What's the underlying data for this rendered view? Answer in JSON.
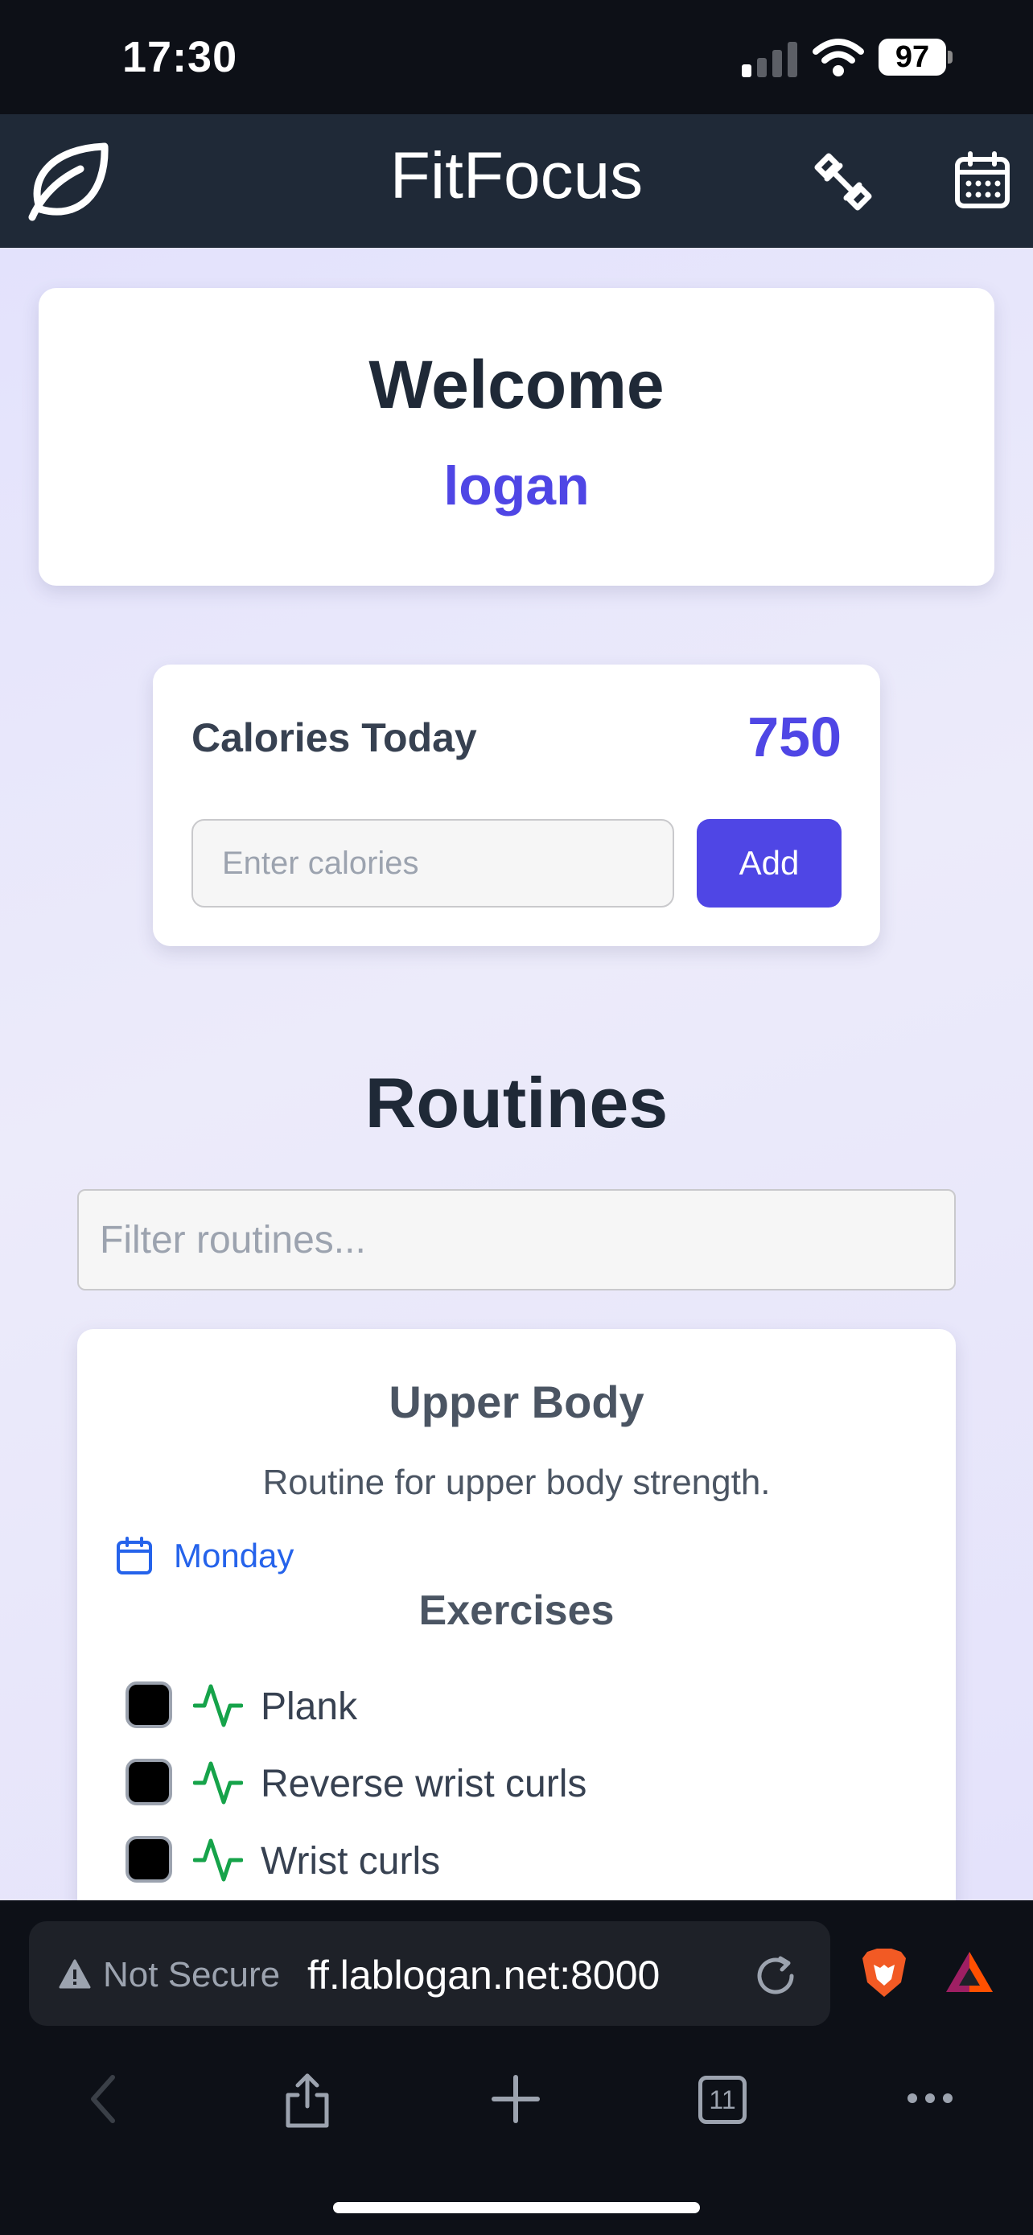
{
  "status_bar": {
    "time": "17:30",
    "battery_level": "97"
  },
  "header": {
    "app_title": "FitFocus",
    "icons": [
      "leaf-icon",
      "dumbbell-icon",
      "calendar-icon"
    ]
  },
  "welcome": {
    "title": "Welcome",
    "username": "logan"
  },
  "calories": {
    "label": "Calories Today",
    "value": "750",
    "input_placeholder": "Enter calories",
    "add_label": "Add"
  },
  "routines": {
    "title": "Routines",
    "filter_placeholder": "Filter routines...",
    "items": [
      {
        "name": "Upper Body",
        "description": "Routine for upper body strength.",
        "day": "Monday",
        "exercises_title": "Exercises",
        "exercises": [
          "Plank",
          "Reverse wrist curls",
          "Wrist curls"
        ]
      }
    ]
  },
  "browser": {
    "security_label": "Not Secure",
    "url": "ff.lablogan.net:8000",
    "tab_count": "11"
  },
  "colors": {
    "accent": "#4f46e5",
    "header_bg": "#1f2937",
    "day_blue": "#2563eb",
    "pulse_green": "#16a34a"
  }
}
